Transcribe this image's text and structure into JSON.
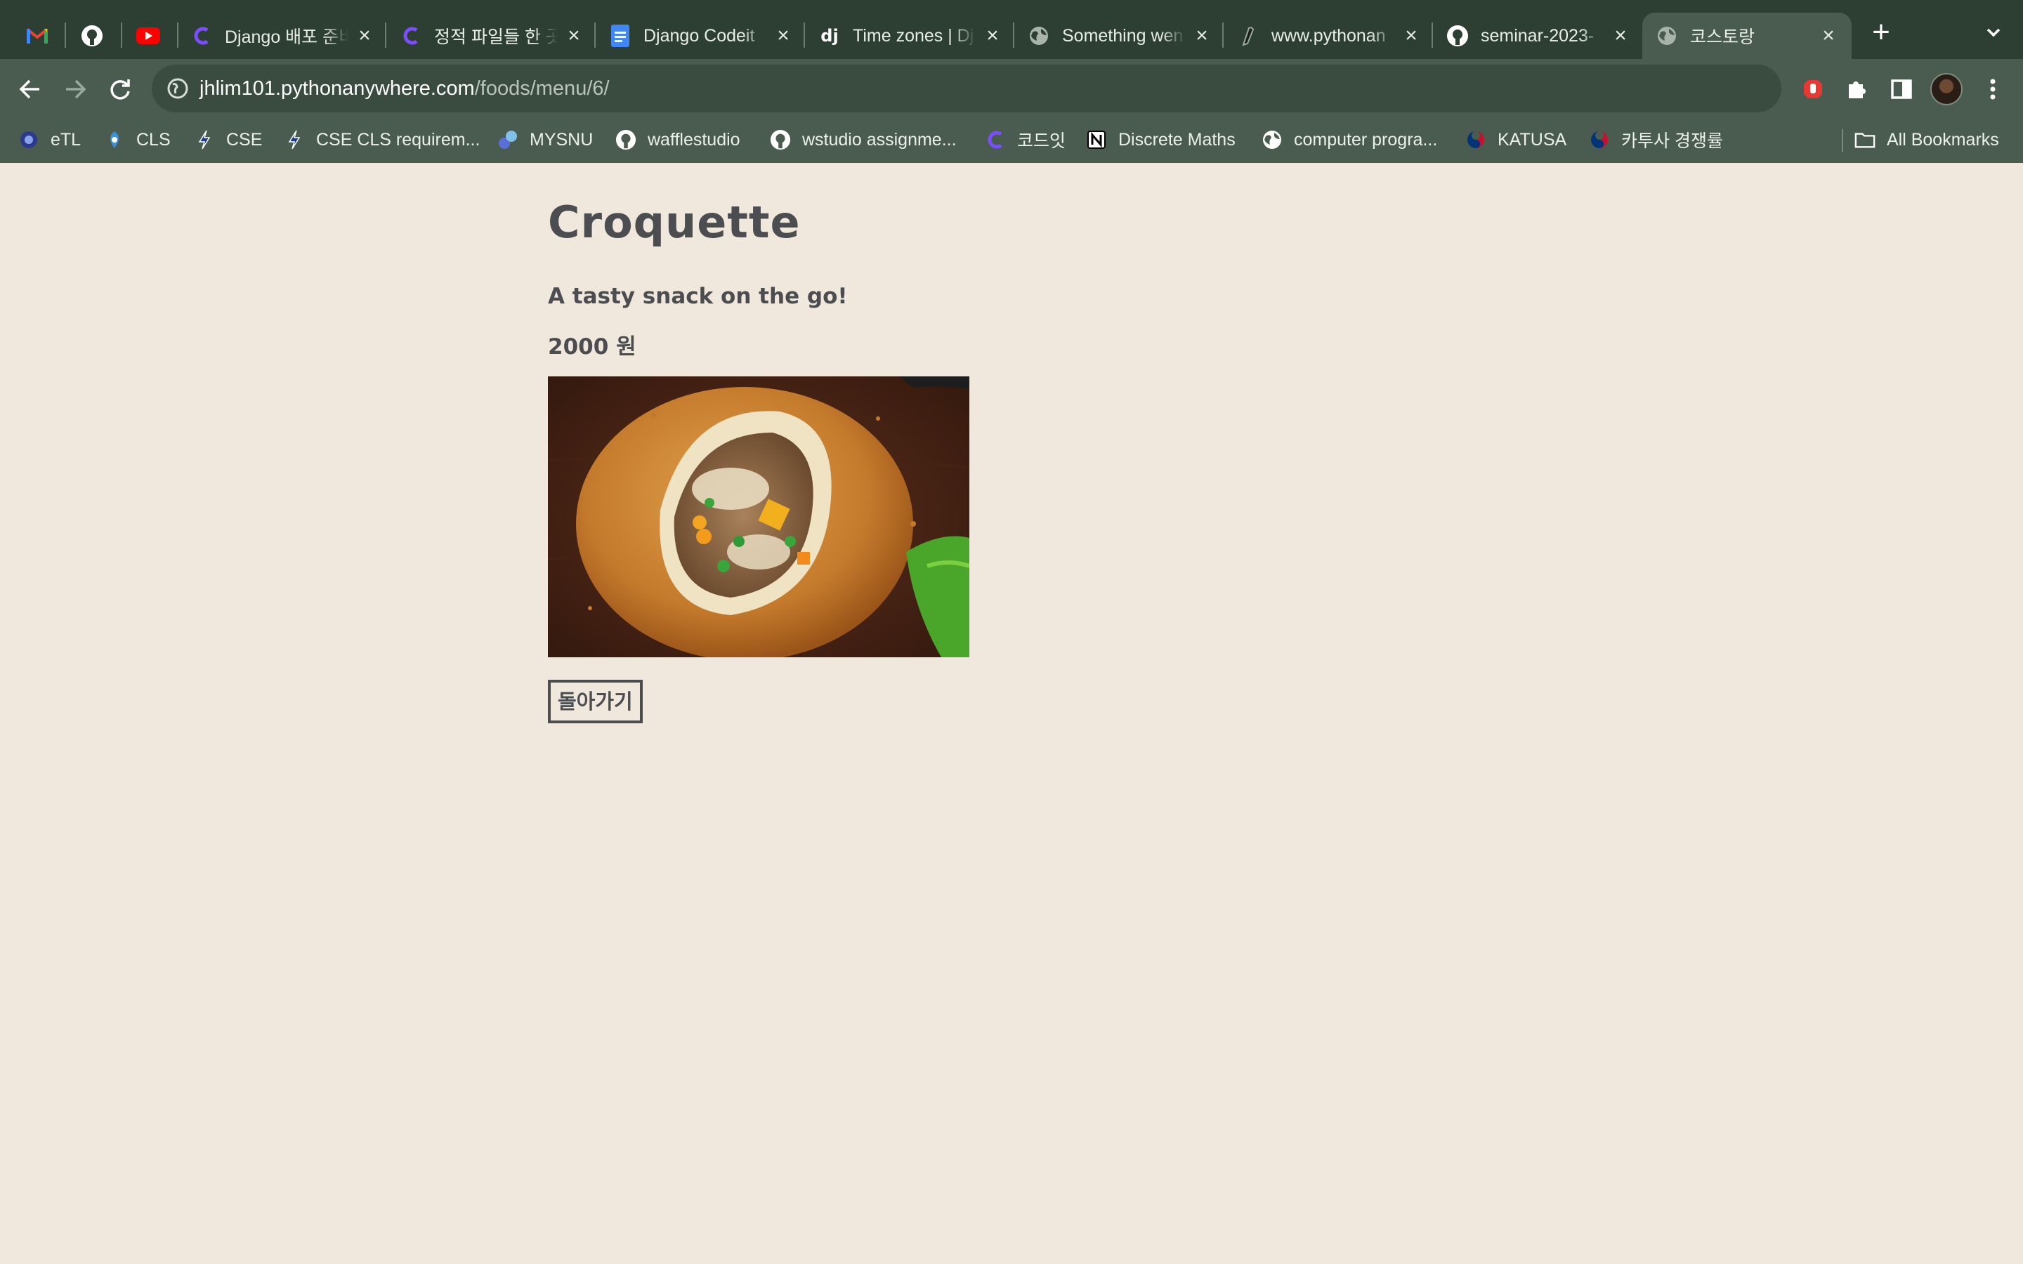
{
  "browser": {
    "tabs": [
      {
        "title": "",
        "icon": "gmail-icon"
      },
      {
        "title": "",
        "icon": "github-icon"
      },
      {
        "title": "",
        "icon": "youtube-icon"
      },
      {
        "title": "Django 배포 준비",
        "icon": "codeit-icon"
      },
      {
        "title": "정적 파일들 한 곳",
        "icon": "codeit-icon"
      },
      {
        "title": "Django Codeit",
        "icon": "docs-icon"
      },
      {
        "title": "Time zones | Dj",
        "icon": "django-icon"
      },
      {
        "title": "Something wen",
        "icon": "globe-icon"
      },
      {
        "title": "www.pythonan",
        "icon": "pythonanywhere-icon"
      },
      {
        "title": "seminar-2023-",
        "icon": "github-icon"
      },
      {
        "title": "코스토랑",
        "icon": "globe-icon",
        "active": true
      }
    ],
    "url": {
      "host": "jhlim101.pythonanywhere.com",
      "path": "/foods/menu/6/"
    },
    "bookmarks": [
      {
        "label": "eTL",
        "icon": "snu-icon"
      },
      {
        "label": "CLS",
        "icon": "cls-icon"
      },
      {
        "label": "CSE",
        "icon": "cse-icon"
      },
      {
        "label": "CSE CLS requirem...",
        "icon": "cse-icon"
      },
      {
        "label": "MYSNU",
        "icon": "mysnu-icon"
      },
      {
        "label": "wafflestudio",
        "icon": "github-icon"
      },
      {
        "label": "wstudio assignme...",
        "icon": "github-icon"
      },
      {
        "label": "코드잇",
        "icon": "codeit-icon"
      },
      {
        "label": "Discrete Maths",
        "icon": "notion-icon"
      },
      {
        "label": "computer progra...",
        "icon": "globe-icon"
      },
      {
        "label": "KATUSA",
        "icon": "katusa-icon"
      },
      {
        "label": "카투사 경쟁률",
        "icon": "katusa-icon"
      }
    ],
    "all_bookmarks_label": "All Bookmarks"
  },
  "page": {
    "title": "Croquette",
    "description": "A tasty snack on the go!",
    "price": "2000 원",
    "image_alt": "croquette-photo",
    "back_button": "돌아가기"
  }
}
